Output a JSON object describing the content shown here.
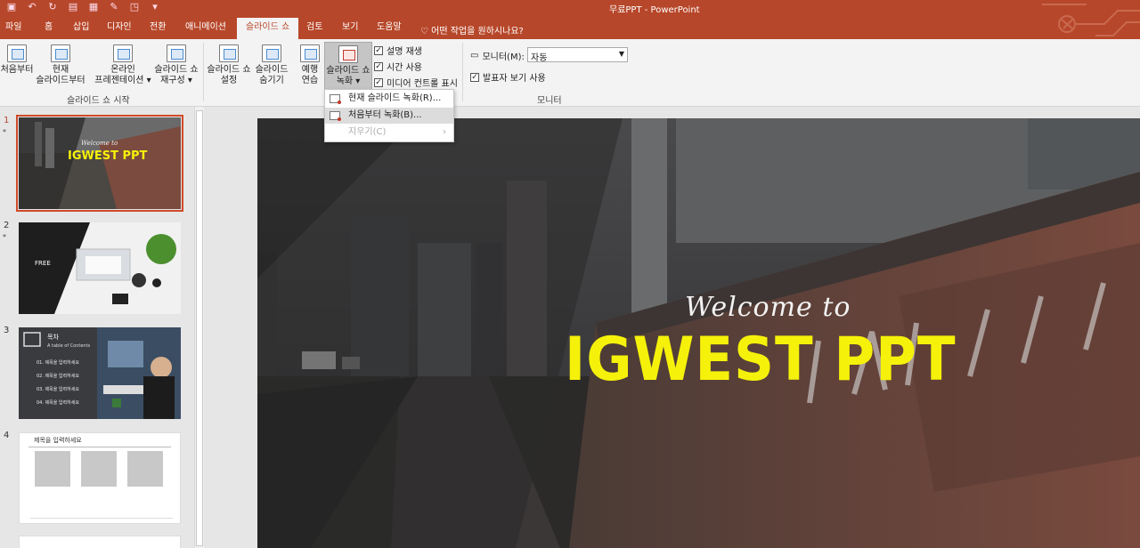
{
  "app": {
    "title": "무료PPT  -  PowerPoint"
  },
  "qat": {
    "icons": [
      "save-icon",
      "undo-icon",
      "redo-icon",
      "present-icon",
      "layout-icon",
      "paint-icon",
      "shape-icon",
      "arrange-icon"
    ]
  },
  "tabs": [
    {
      "label": "파일"
    },
    {
      "label": "홈"
    },
    {
      "label": "삽입"
    },
    {
      "label": "디자인"
    },
    {
      "label": "전환"
    },
    {
      "label": "애니메이션"
    },
    {
      "label": "슬라이드 쇼"
    },
    {
      "label": "검토"
    },
    {
      "label": "보기"
    },
    {
      "label": "도움말"
    }
  ],
  "tellme": "어떤 작업을 원하시나요?",
  "ribbon": {
    "start_group": {
      "label": "슬라이드 쇼 시작",
      "from_start": "처음부터",
      "from_current_1": "현재",
      "from_current_2": "슬라이드부터",
      "online_1": "온라인",
      "online_2": "프레젠테이션 ▾",
      "custom_1": "슬라이드 쇼",
      "custom_2": "재구성 ▾"
    },
    "setup_group": {
      "setup_1": "슬라이드 쇼",
      "setup_2": "설정",
      "hide_1": "슬라이드",
      "hide_2": "숨기기",
      "rehearse_1": "예행",
      "rehearse_2": "연습",
      "record_1": "슬라이드 쇼",
      "record_2": "녹화 ▾",
      "play_narration": "설명 재생",
      "use_timings": "시간 사용",
      "show_media": "미디어 컨트롤 표시"
    },
    "monitor_group": {
      "label": "모니터",
      "monitor_label": "모니터(M):",
      "monitor_value": "자동",
      "presenter_view": "발표자 보기 사용"
    }
  },
  "dropdown": {
    "items": [
      {
        "label": "현재 슬라이드 녹화(R)..."
      },
      {
        "label": "처음부터 녹화(B)..."
      },
      {
        "label": "지우기(C)"
      }
    ]
  },
  "thumbnails": [
    {
      "num": "1",
      "star": "*",
      "welcome": "Welcome to",
      "title": "IGWEST PPT"
    },
    {
      "num": "2",
      "star": "*",
      "label": "FREE"
    },
    {
      "num": "3",
      "title": "목차",
      "sub": "A table of Contents",
      "rows": [
        "01. 제목을 입력하세요",
        "02. 제목을 입력하세요",
        "03. 제목을 입력하세요",
        "04. 제목을 입력하세요"
      ]
    },
    {
      "num": "4",
      "title": "제목을 입력하세요"
    }
  ],
  "slide": {
    "welcome": "Welcome to",
    "title": "IGWEST PPT"
  },
  "colors": {
    "accent": "#b7472a",
    "title_yellow": "#f5f10a"
  }
}
